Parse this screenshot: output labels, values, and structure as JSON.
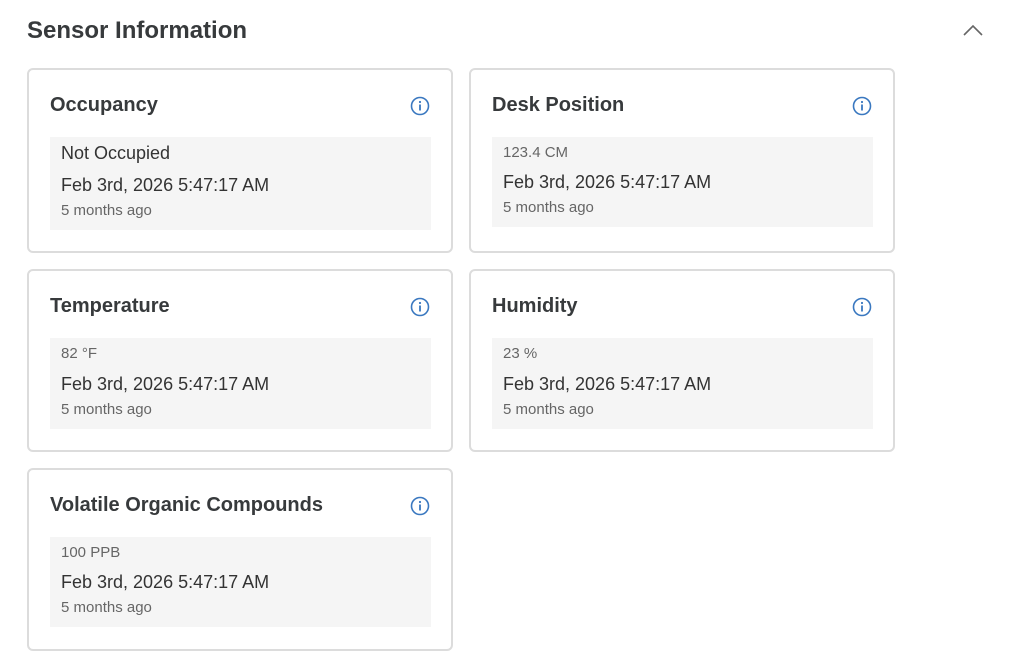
{
  "section": {
    "title": "Sensor Information",
    "collapse_icon": "chevron-up-icon"
  },
  "colors": {
    "accent": "#3a78c0",
    "card_border": "#dcdcdc",
    "reading_bg": "#f5f5f5"
  },
  "cards": [
    {
      "title": "Occupancy",
      "icon": "info-icon",
      "value": "Not Occupied",
      "timestamp": "Feb 3rd, 2026 5:47:17 AM",
      "relative": "5 months ago"
    },
    {
      "title": "Desk Position",
      "icon": "info-icon",
      "value": "123.4 CM",
      "timestamp": "Feb 3rd, 2026 5:47:17 AM",
      "relative": "5 months ago"
    },
    {
      "title": "Temperature",
      "icon": "info-icon",
      "value": "82 °F",
      "timestamp": "Feb 3rd, 2026 5:47:17 AM",
      "relative": "5 months ago"
    },
    {
      "title": "Humidity",
      "icon": "info-icon",
      "value": "23 %",
      "timestamp": "Feb 3rd, 2026 5:47:17 AM",
      "relative": "5 months ago"
    },
    {
      "title": "Volatile Organic Compounds",
      "icon": "info-icon",
      "value": "100 PPB",
      "timestamp": "Feb 3rd, 2026 5:47:17 AM",
      "relative": "5 months ago"
    }
  ]
}
